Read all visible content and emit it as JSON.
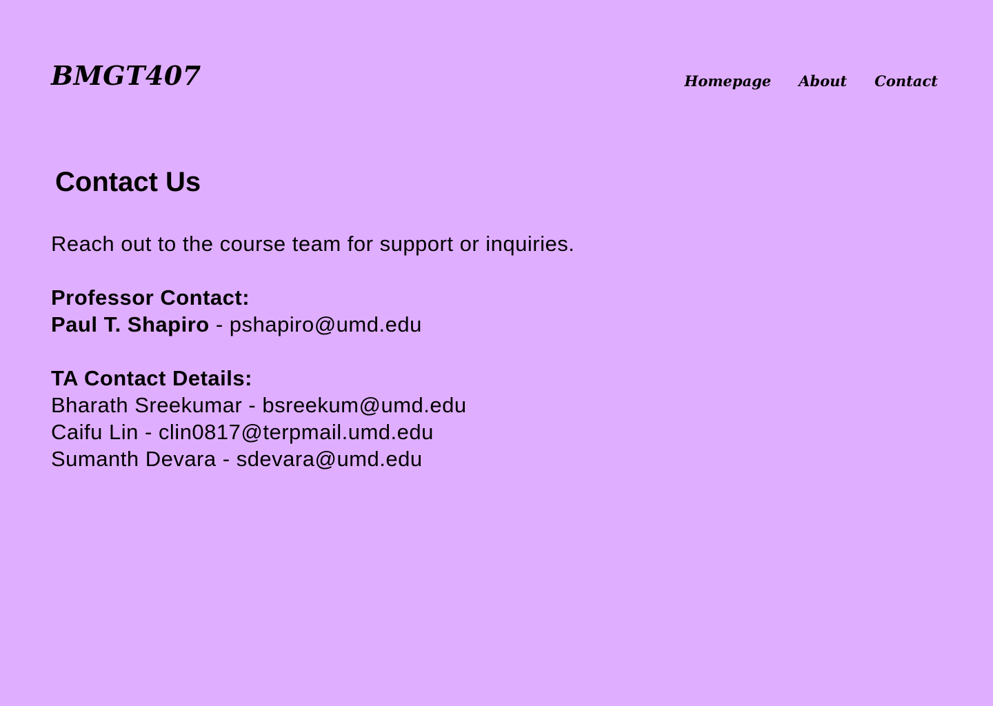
{
  "header": {
    "brand": "BMGT407",
    "nav": [
      {
        "label": "Homepage"
      },
      {
        "label": "About"
      },
      {
        "label": "Contact"
      }
    ]
  },
  "main": {
    "title": "Contact Us",
    "intro": "Reach out to the course team for support or inquiries.",
    "professor": {
      "heading": "Professor Contact:",
      "name": "Paul T. Shapiro",
      "separator": " - ",
      "email": "pshapiro@umd.edu"
    },
    "ta": {
      "heading": "TA Contact Details:",
      "contacts": [
        {
          "name": "Bharath Sreekumar",
          "separator": " - ",
          "email": "bsreekum@umd.edu"
        },
        {
          "name": "Caifu Lin",
          "separator": " - ",
          "email": "clin0817@terpmail.umd.edu"
        },
        {
          "name": "Sumanth Devara",
          "separator": " - ",
          "email": "sdevara@umd.edu"
        }
      ]
    }
  },
  "colors": {
    "background": "#dfaeff",
    "text": "#000000"
  }
}
